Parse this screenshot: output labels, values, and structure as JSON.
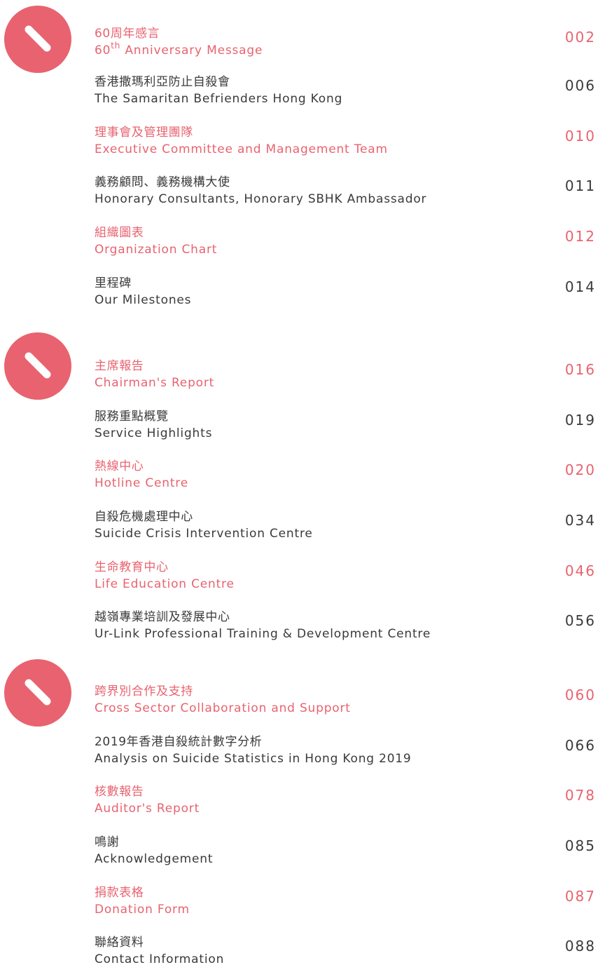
{
  "colors": {
    "accent": "#e8636f",
    "text": "#3a3a3a",
    "background": "#ffffff"
  },
  "icons": {
    "section_badge": "slash-circle-icon"
  },
  "entries": [
    {
      "zh": "60周年感言",
      "en_prefix": "60",
      "en_sup": "th",
      "en_rest": " Anniversary Message",
      "page": "002"
    },
    {
      "zh": "香港撒瑪利亞防止自殺會",
      "en": "The Samaritan Befrienders Hong Kong",
      "page": "006"
    },
    {
      "zh": "理事會及管理團隊",
      "en": "Executive Committee and Management Team",
      "page": "010"
    },
    {
      "zh": "義務顧問、義務機構大使",
      "en": "Honorary Consultants, Honorary SBHK Ambassador",
      "page": "011"
    },
    {
      "zh": "組織圖表",
      "en": "Organization Chart",
      "page": "012"
    },
    {
      "zh": "里程碑",
      "en": "Our Milestones",
      "page": "014"
    },
    {
      "zh": "主席報告",
      "en": "Chairman's Report",
      "page": "016"
    },
    {
      "zh": "服務重點概覽",
      "en": "Service Highlights",
      "page": "019"
    },
    {
      "zh": "熱線中心",
      "en": "Hotline Centre",
      "page": "020"
    },
    {
      "zh": "自殺危機處理中心",
      "en": "Suicide Crisis Intervention Centre",
      "page": "034"
    },
    {
      "zh": "生命教育中心",
      "en": "Life Education Centre",
      "page": "046"
    },
    {
      "zh": "越嶺專業培訓及發展中心",
      "en": "Ur-Link Professional Training & Development Centre",
      "page": "056"
    },
    {
      "zh": "跨界別合作及支持",
      "en": "Cross Sector Collaboration and Support",
      "page": "060"
    },
    {
      "zh": "2019年香港自殺統計數字分析",
      "en": "Analysis on Suicide Statistics in Hong Kong 2019",
      "page": "066"
    },
    {
      "zh": "核數報告",
      "en": "Auditor's Report",
      "page": "078"
    },
    {
      "zh": "鳴謝",
      "en": "Acknowledgement",
      "page": "085"
    },
    {
      "zh": "捐款表格",
      "en": "Donation Form",
      "page": "087"
    },
    {
      "zh": "聯絡資料",
      "en": "Contact Information",
      "page": "088"
    }
  ]
}
